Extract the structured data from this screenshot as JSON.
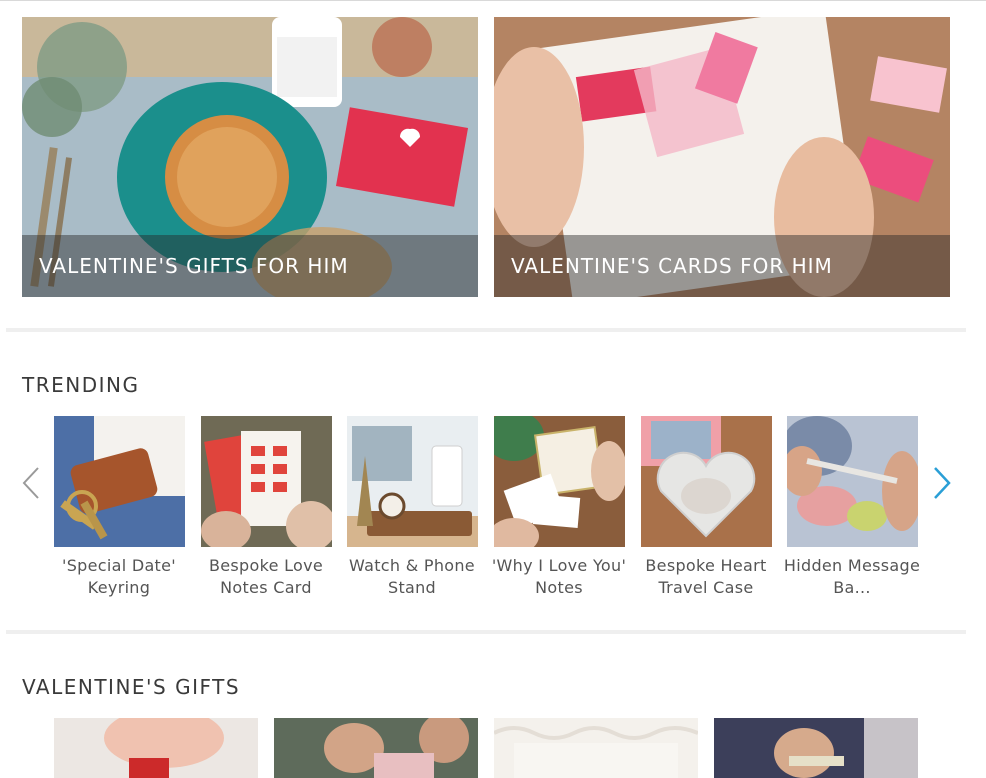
{
  "hero_banners": [
    {
      "caption": "VALENTINE'S GIFTS FOR HIM",
      "image": "pie-and-card-photo"
    },
    {
      "caption": "VALENTINE'S CARDS FOR HIM",
      "image": "tokens-of-affection-card-photo"
    }
  ],
  "trending": {
    "title": "TRENDING",
    "prev_icon": "chevron-left-icon",
    "next_icon": "chevron-right-icon",
    "products": [
      {
        "name": "'Special Date' Keyring"
      },
      {
        "name": "Bespoke Love Notes Card"
      },
      {
        "name": "Watch & Phone Stand"
      },
      {
        "name": "'Why I Love You' Notes"
      },
      {
        "name": "Bespoke Heart Travel Case"
      },
      {
        "name": "Hidden Message Ba..."
      }
    ]
  },
  "valentines_gifts": {
    "title": "VALENTINE'S GIFTS",
    "tiles": 4
  },
  "colors": {
    "arrow_next": "#2a9fd6",
    "arrow_prev": "#9a9a9a",
    "caption_overlay": "#282828"
  }
}
